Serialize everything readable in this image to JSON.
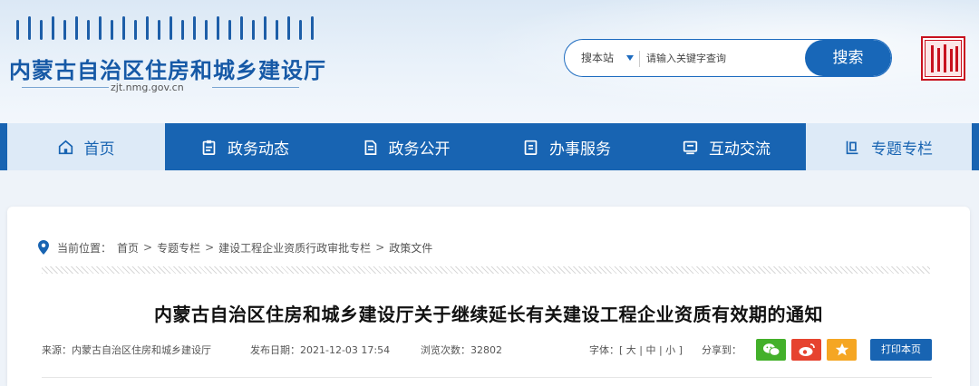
{
  "header": {
    "site_title": "内蒙古自治区住房和城乡建设厅",
    "site_domain": "zjt.nmg.gov.cn",
    "search": {
      "scope_label": "搜本站",
      "placeholder": "请输入关键字查询",
      "button_label": "搜索"
    }
  },
  "nav": {
    "items": [
      {
        "label": "首页",
        "icon": "home-icon"
      },
      {
        "label": "政务动态",
        "icon": "clipboard-icon"
      },
      {
        "label": "政务公开",
        "icon": "document-icon"
      },
      {
        "label": "办事服务",
        "icon": "service-icon"
      },
      {
        "label": "互动交流",
        "icon": "chat-icon"
      },
      {
        "label": "专题专栏",
        "icon": "column-icon"
      }
    ]
  },
  "breadcrumb": {
    "prefix": "当前位置：",
    "items": [
      "首页",
      "专题专栏",
      "建设工程企业资质行政审批专栏",
      "政策文件"
    ],
    "separator": ">"
  },
  "article": {
    "title": "内蒙古自治区住房和城乡建设厅关于继续延长有关建设工程企业资质有效期的通知",
    "source": "来源：内蒙古自治区住房和城乡建设厅",
    "date": "发布日期：2021-12-03 17:54",
    "views": "浏览次数：32802",
    "font_size": "字体：[ 大 | 中 | 小 ]",
    "share_label": "分享到：",
    "print_label": "打印本页"
  },
  "colors": {
    "brand_blue": "#1864b2",
    "nav_light": "#ddeaf7",
    "wechat_green": "#43b02a",
    "weibo_red": "#e6432f",
    "favorite_orange": "#f5a623",
    "seal_red": "#c8111e"
  }
}
